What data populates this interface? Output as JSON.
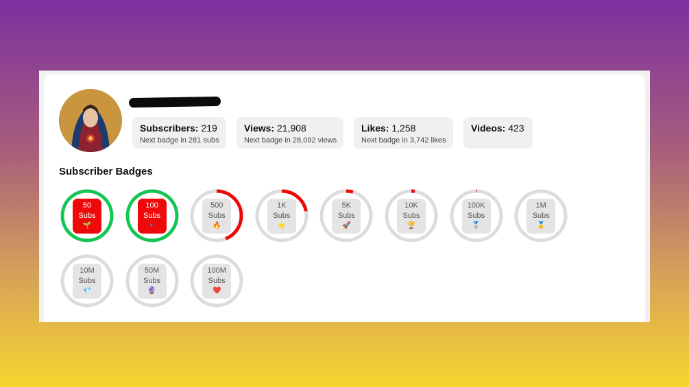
{
  "channel": {
    "name_redacted": true
  },
  "stats": [
    {
      "label": "Subscribers:",
      "value": "219",
      "sub": "Next badge in 281 subs"
    },
    {
      "label": "Views:",
      "value": "21,908",
      "sub": "Next badge in 28,092 views"
    },
    {
      "label": "Likes:",
      "value": "1,258",
      "sub": "Next badge in 3,742 likes"
    },
    {
      "label": "Videos:",
      "value": "423",
      "sub": ""
    }
  ],
  "badges_section": {
    "title": "Subscriber Badges"
  },
  "badges": [
    {
      "amount": "50",
      "unit": "Subs",
      "emoji": "🌱",
      "earned": true,
      "progress": 1.0
    },
    {
      "amount": "100",
      "unit": "Subs",
      "emoji": "🔹",
      "earned": true,
      "progress": 1.0
    },
    {
      "amount": "500",
      "unit": "Subs",
      "emoji": "🔥",
      "earned": false,
      "progress": 0.44
    },
    {
      "amount": "1K",
      "unit": "Subs",
      "emoji": "⭐",
      "earned": false,
      "progress": 0.22
    },
    {
      "amount": "5K",
      "unit": "Subs",
      "emoji": "🚀",
      "earned": false,
      "progress": 0.044
    },
    {
      "amount": "10K",
      "unit": "Subs",
      "emoji": "🏆",
      "earned": false,
      "progress": 0.022
    },
    {
      "amount": "100K",
      "unit": "Subs",
      "emoji": "🥈",
      "earned": false,
      "progress": 0.0022
    },
    {
      "amount": "1M",
      "unit": "Subs",
      "emoji": "🥇",
      "earned": false,
      "progress": 0.0
    },
    {
      "amount": "10M",
      "unit": "Subs",
      "emoji": "💎",
      "earned": false,
      "progress": 0.0
    },
    {
      "amount": "50M",
      "unit": "Subs",
      "emoji": "🔮",
      "earned": false,
      "progress": 0.0
    },
    {
      "amount": "100M",
      "unit": "Subs",
      "emoji": "❤️",
      "earned": false,
      "progress": 0.0
    }
  ],
  "colors": {
    "earned_ring": "#16c553",
    "progress_ring": "#ee0a0a",
    "track_ring": "#dcdcdc",
    "earned_fill": "#ee0a0a"
  }
}
